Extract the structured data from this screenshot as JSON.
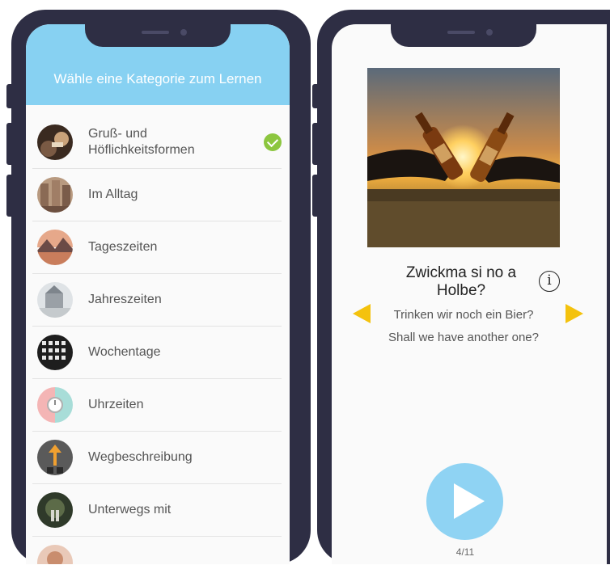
{
  "left": {
    "header_title": "Wähle eine Kategorie zum Lernen",
    "categories": [
      {
        "label": "Gruß- und Höflichkeitsformen",
        "done": true
      },
      {
        "label": "Im Alltag",
        "done": false
      },
      {
        "label": "Tageszeiten",
        "done": false
      },
      {
        "label": "Jahreszeiten",
        "done": false
      },
      {
        "label": "Wochentage",
        "done": false
      },
      {
        "label": "Uhrzeiten",
        "done": false
      },
      {
        "label": "Wegbeschreibung",
        "done": false
      },
      {
        "label": "Unterwegs mit",
        "done": false
      }
    ]
  },
  "right": {
    "phrase": "Zwickma si no a Holbe?",
    "translation_de": "Trinken wir noch ein Bier?",
    "translation_en": "Shall we have another one?",
    "counter": "4/11",
    "info_symbol": "i"
  },
  "colors": {
    "header": "#87d1f2",
    "frame": "#2e2e44",
    "check": "#8cc63f",
    "arrow": "#f4c20d",
    "play": "#8fd3f3"
  },
  "icons": {
    "check": "check-circle-icon",
    "info": "info-icon",
    "prev": "arrow-left-icon",
    "next": "arrow-right-icon",
    "play": "play-icon"
  }
}
